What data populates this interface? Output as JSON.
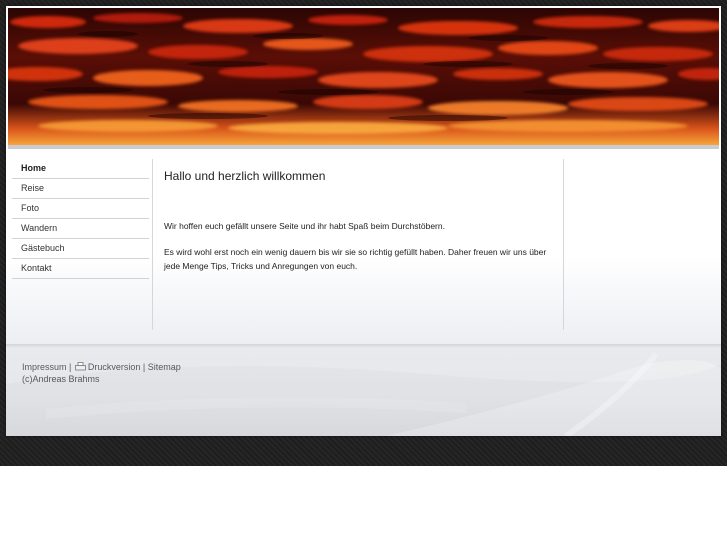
{
  "nav": {
    "items": [
      {
        "label": "Home",
        "active": true
      },
      {
        "label": "Reise"
      },
      {
        "label": "Foto"
      },
      {
        "label": "Wandern"
      },
      {
        "label": "Gästebuch"
      },
      {
        "label": "Kontakt"
      }
    ]
  },
  "main": {
    "title": "Hallo und herzlich willkommen",
    "paragraph1": "Wir hoffen euch gefällt unsere Seite  und ihr habt Spaß beim Durchstöbern.",
    "paragraph2": "Es wird wohl erst noch ein wenig dauern bis wir sie so richtig gefüllt haben. Daher freuen wir uns über jede Menge Tips, Tricks und Anregungen von euch."
  },
  "footer": {
    "impressum": "Impressum",
    "separator": "|",
    "druckversion": "Druckversion",
    "sitemap": "Sitemap",
    "copyright": "(c)Andreas Brahms",
    "printer_icon": "printer-icon"
  },
  "colors": {
    "sky_dark": "#1a0402",
    "sky_red": "#c41d0a",
    "sky_orange": "#f07a1c",
    "nav_border": "#cfd2d6"
  }
}
